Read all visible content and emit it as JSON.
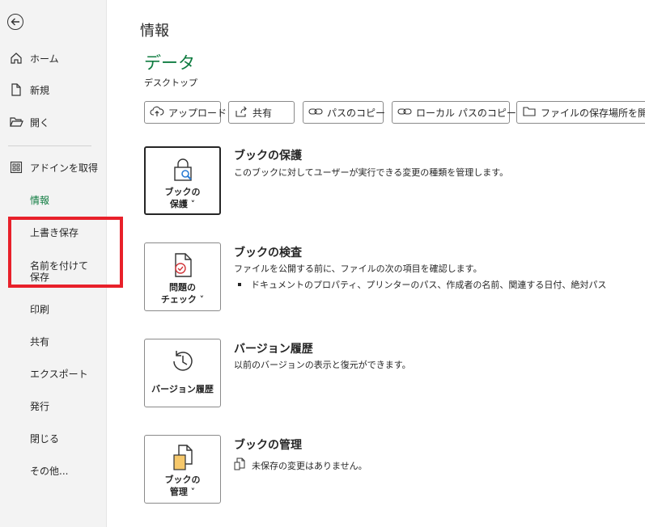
{
  "sidebar": {
    "items": [
      {
        "label": "ホーム",
        "icon": "home-icon"
      },
      {
        "label": "新規",
        "icon": "new-document-icon"
      },
      {
        "label": "開く",
        "icon": "folder-open-icon"
      },
      {
        "label": "アドインを取得",
        "icon": "addins-grid-icon"
      },
      {
        "label": "情報"
      },
      {
        "label": "上書き保存"
      },
      {
        "label": "名前を付けて保存"
      },
      {
        "label": "印刷"
      },
      {
        "label": "共有"
      },
      {
        "label": "エクスポート"
      },
      {
        "label": "発行"
      },
      {
        "label": "閉じる"
      },
      {
        "label": "その他..."
      }
    ],
    "active_color": "#107c41"
  },
  "main": {
    "title": "情報",
    "doc_name": "データ",
    "doc_path": "デスクトップ",
    "actions": [
      {
        "label": "アップロード",
        "icon": "cloud-upload-icon"
      },
      {
        "label": "共有",
        "icon": "share-icon"
      },
      {
        "label": "パスのコピー",
        "icon": "link-icon"
      },
      {
        "label": "ローカル パスのコピー",
        "icon": "link-icon"
      },
      {
        "label": "ファイルの保存場所を開く",
        "icon": "folder-icon"
      }
    ],
    "sections": [
      {
        "button_label": "ブックの\n保護 ˅",
        "title": "ブックの保護",
        "desc": "このブックに対してユーザーが実行できる変更の種類を管理します。"
      },
      {
        "button_label": "問題の\nチェック ˅",
        "title": "ブックの検査",
        "desc": "ファイルを公開する前に、ファイルの次の項目を確認します。",
        "bullet": "ドキュメントのプロパティ、プリンターのパス、作成者の名前、関連する日付、絶対パス"
      },
      {
        "button_label": "バージョン履歴",
        "title": "バージョン履歴",
        "desc": "以前のバージョンの表示と復元ができます。"
      },
      {
        "button_label": "ブックの\n管理 ˅",
        "title": "ブックの管理",
        "status": "未保存の変更はありません。"
      }
    ]
  },
  "colors": {
    "accent": "#107c41",
    "highlight": "#e8202a"
  }
}
